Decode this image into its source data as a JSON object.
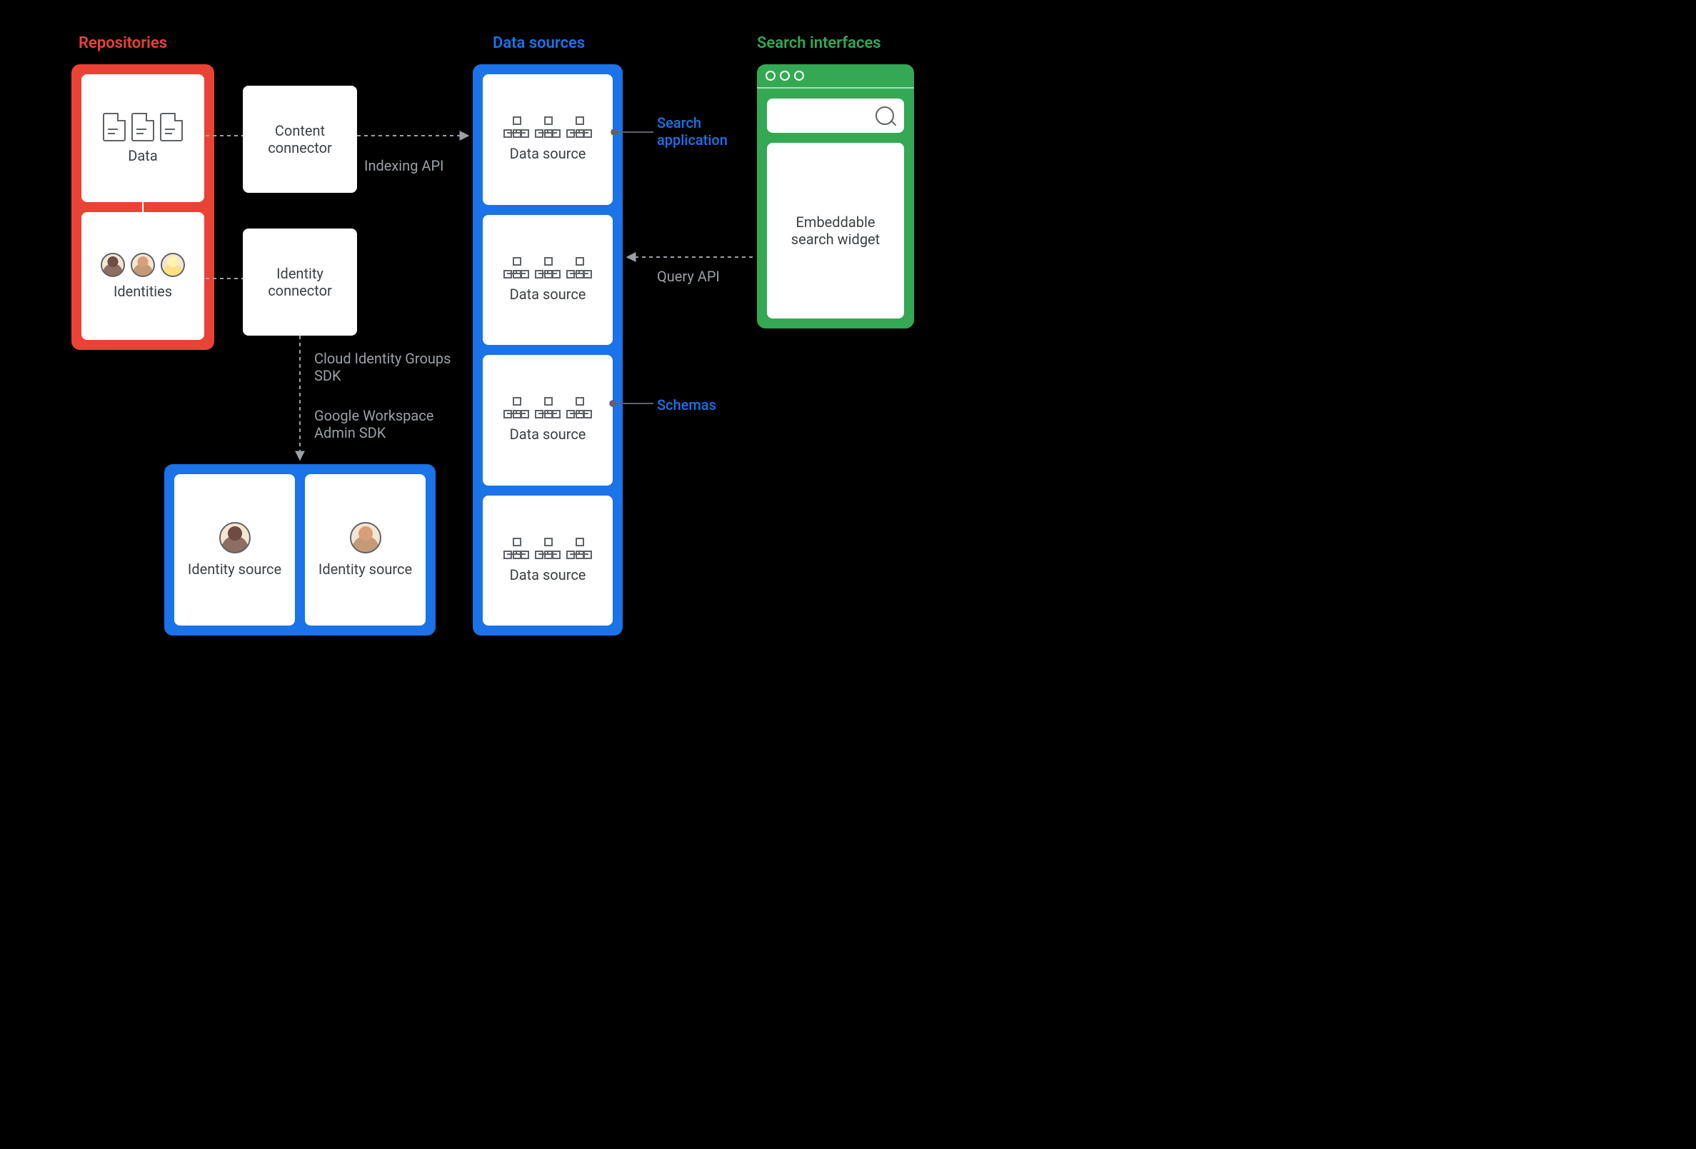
{
  "titles": {
    "repositories": "Repositories",
    "data_sources": "Data sources",
    "search_interfaces": "Search interfaces"
  },
  "repositories": {
    "data_label": "Data",
    "identities_label": "Identities"
  },
  "connectors": {
    "content": "Content connector",
    "identity": "Identity connector"
  },
  "data_sources": {
    "item_label": "Data source",
    "count": 4
  },
  "identity_sources": {
    "item_label": "Identity source",
    "count": 2
  },
  "search_interface": {
    "widget_label": "Embeddable search widget"
  },
  "edge_labels": {
    "indexing_api": "Indexing API",
    "cloud_identity_sdk": "Cloud Identity Groups SDK",
    "workspace_admin_sdk": "Google Workspace Admin SDK",
    "query_api": "Query API",
    "search_application": "Search application",
    "schemas": "Schemas"
  },
  "colors": {
    "red": "#ea4335",
    "blue": "#1a73e8",
    "green": "#34a853",
    "gray": "#9aa0a6"
  }
}
